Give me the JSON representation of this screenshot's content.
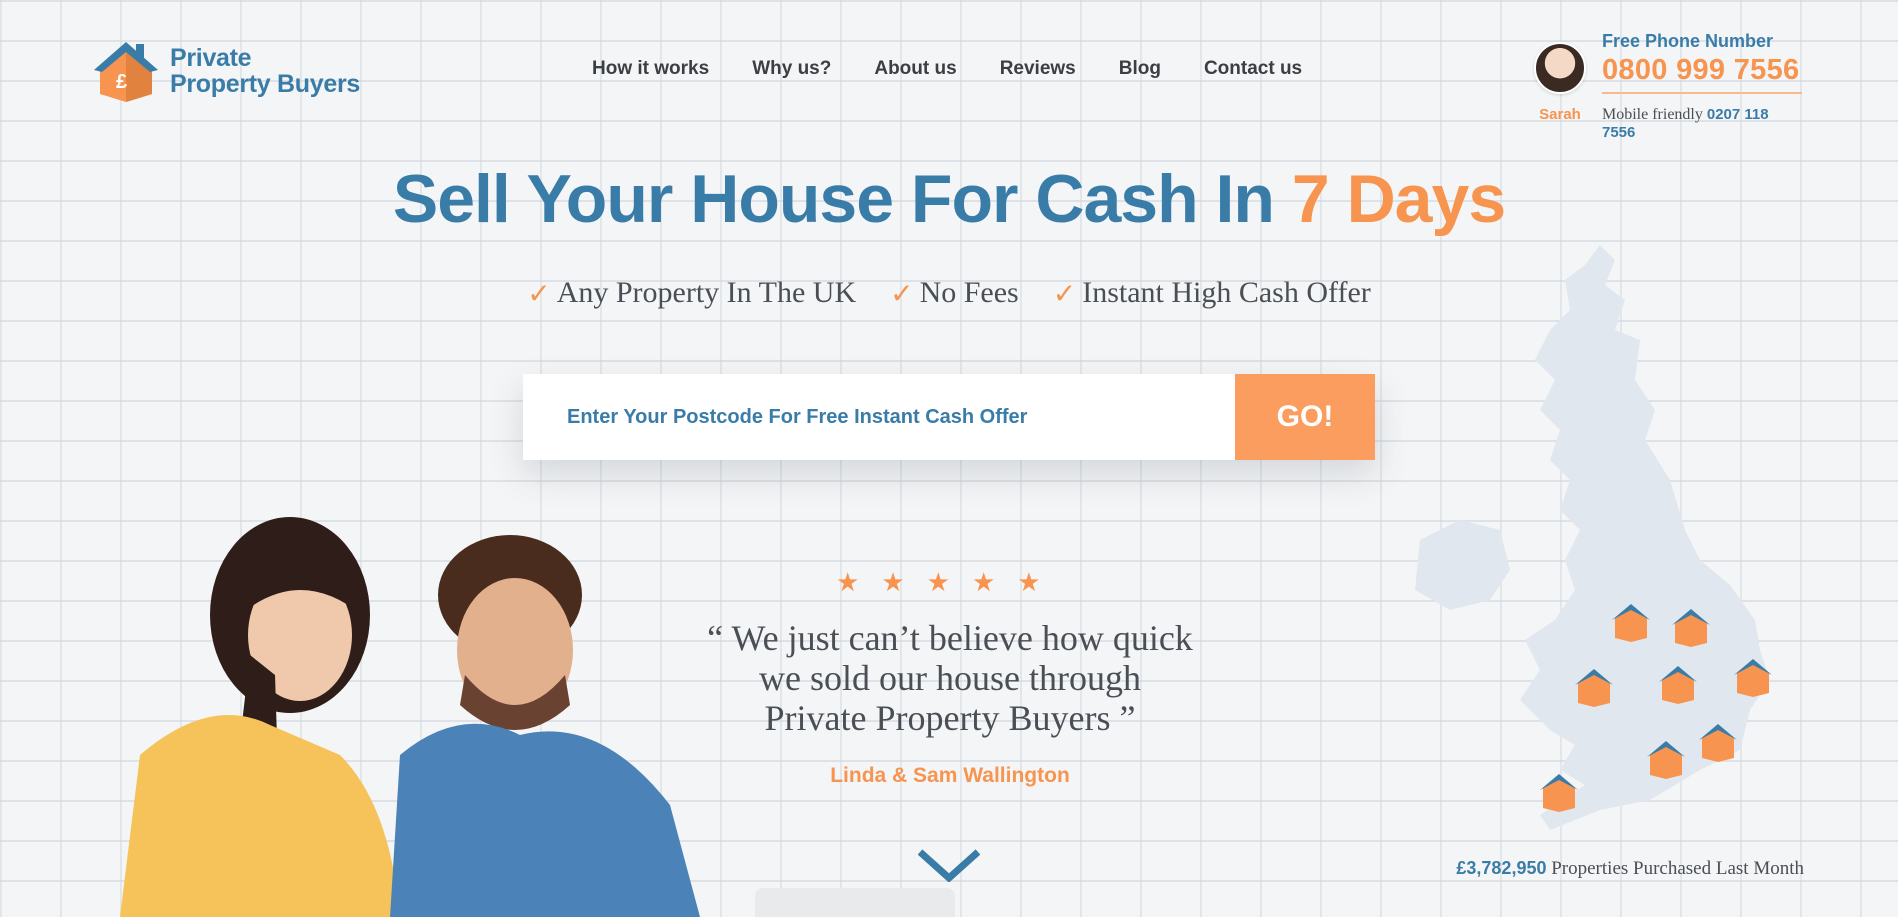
{
  "brand": {
    "name_line1": "Private",
    "name_line2": "Property Buyers"
  },
  "nav": [
    {
      "label": "How it works"
    },
    {
      "label": "Why us?"
    },
    {
      "label": "About us"
    },
    {
      "label": "Reviews"
    },
    {
      "label": "Blog"
    },
    {
      "label": "Contact us"
    }
  ],
  "contact": {
    "agent_name": "Sarah",
    "free_phone_label": "Free Phone Number",
    "free_phone": "0800 999 7556",
    "mobile_label": "Mobile friendly",
    "mobile_phone": "0207 118 7556"
  },
  "hero": {
    "headline_main": "Sell Your House For Cash In ",
    "headline_highlight": "7 Days",
    "benefits": [
      "Any Property In The UK",
      "No Fees",
      "Instant High Cash Offer"
    ],
    "postcode_placeholder": "Enter Your Postcode For Free Instant Cash Offer",
    "go_label": "GO!"
  },
  "testimonial": {
    "rating": 5,
    "quote_line1": "“ We just can’t believe how quick",
    "quote_line2": "we sold our house through",
    "quote_line3": "Private Property Buyers ”",
    "author": "Linda & Sam Wallington"
  },
  "stats": {
    "amount": "£3,782,950",
    "label": "Properties Purchased Last Month"
  },
  "colors": {
    "blue": "#3a7ca8",
    "orange": "#f7944f",
    "text": "#4a4f55"
  },
  "icons": [
    "house-logo-icon",
    "checkmark-icon",
    "star-icon",
    "chevron-down-icon",
    "house-pin-icon",
    "uk-map"
  ]
}
